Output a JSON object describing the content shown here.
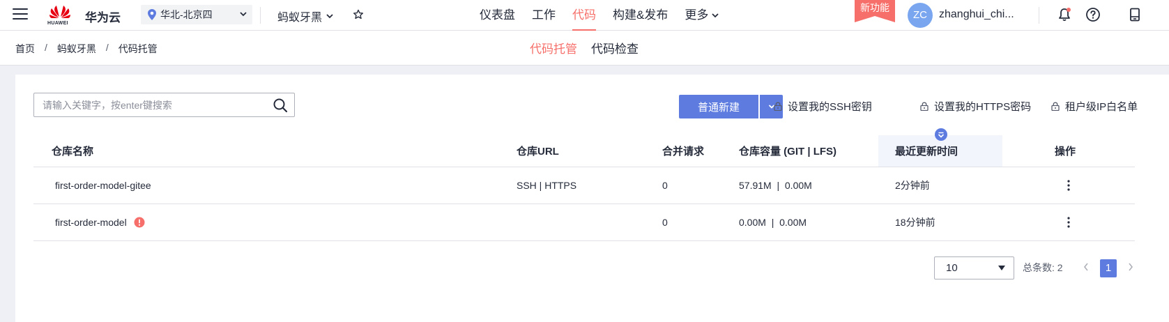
{
  "topbar": {
    "logo_text": "HUAWEI",
    "brand": "华为云",
    "region": "华北-北京四",
    "project": "蚂蚁牙黑",
    "nav": [
      {
        "label": "仪表盘",
        "active": false
      },
      {
        "label": "工作",
        "active": false
      },
      {
        "label": "代码",
        "active": true
      },
      {
        "label": "构建&发布",
        "active": false
      },
      {
        "label": "更多",
        "active": false
      }
    ],
    "new_feature": "新功能",
    "avatar_initials": "ZC",
    "username": "zhanghui_chi..."
  },
  "subbar": {
    "breadcrumbs": [
      "首页",
      "蚂蚁牙黑",
      "代码托管"
    ],
    "breadcrumb_sep": "/",
    "tabs": [
      {
        "label": "代码托管",
        "active": true
      },
      {
        "label": "代码检查",
        "active": false
      }
    ]
  },
  "toolbar": {
    "search_placeholder": "请输入关键字，按enter键搜索",
    "new_button": "普通新建",
    "links": [
      "设置我的SSH密钥",
      "设置我的HTTPS密码",
      "租户级IP白名单"
    ]
  },
  "table": {
    "headers": [
      "仓库名称",
      "仓库URL",
      "合并请求",
      "仓库容量 (GIT | LFS)",
      "最近更新时间",
      "操作"
    ],
    "rows": [
      {
        "name": "first-order-model-gitee",
        "url": "SSH | HTTPS",
        "merge": "0",
        "capacity": "57.91M  |  0.00M",
        "updated": "2分钟前",
        "warning": false
      },
      {
        "name": "first-order-model",
        "url": "",
        "merge": "0",
        "capacity": "0.00M  |  0.00M",
        "updated": "18分钟前",
        "warning": true
      }
    ]
  },
  "pagination": {
    "page_size": "10",
    "total_text": "总条数: 2",
    "current_page": "1"
  },
  "colors": {
    "accent_red": "#f66f6a",
    "primary_blue": "#5e7ce0",
    "avatar_blue": "#7aa6f0"
  }
}
